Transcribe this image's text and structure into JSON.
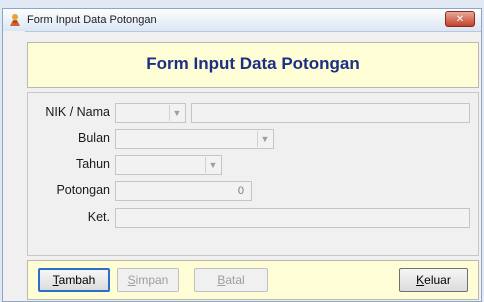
{
  "window": {
    "title": "Form Input Data Potongan",
    "app_icon": "character-icon",
    "close_icon": "close-icon"
  },
  "header": {
    "title": "Form Input Data Potongan"
  },
  "form": {
    "nik_label": "NIK / Nama",
    "nik_value": "",
    "nama_value": "",
    "bulan_label": "Bulan",
    "bulan_value": "",
    "tahun_label": "Tahun",
    "tahun_value": "",
    "potongan_label": "Potongan",
    "potongan_value": "0",
    "ket_label": "Ket.",
    "ket_value": ""
  },
  "buttons": {
    "tambah": {
      "first": "T",
      "rest": "ambah"
    },
    "simpan": {
      "first": "S",
      "rest": "impan"
    },
    "batal": {
      "first": "B",
      "rest": "atal"
    },
    "keluar": {
      "first": "K",
      "rest": "eluar"
    }
  },
  "colors": {
    "header_bg": "#fffdd5",
    "header_title": "#1b2f84",
    "window_bg": "#f0f0f0",
    "close_button": "#c2412c"
  }
}
